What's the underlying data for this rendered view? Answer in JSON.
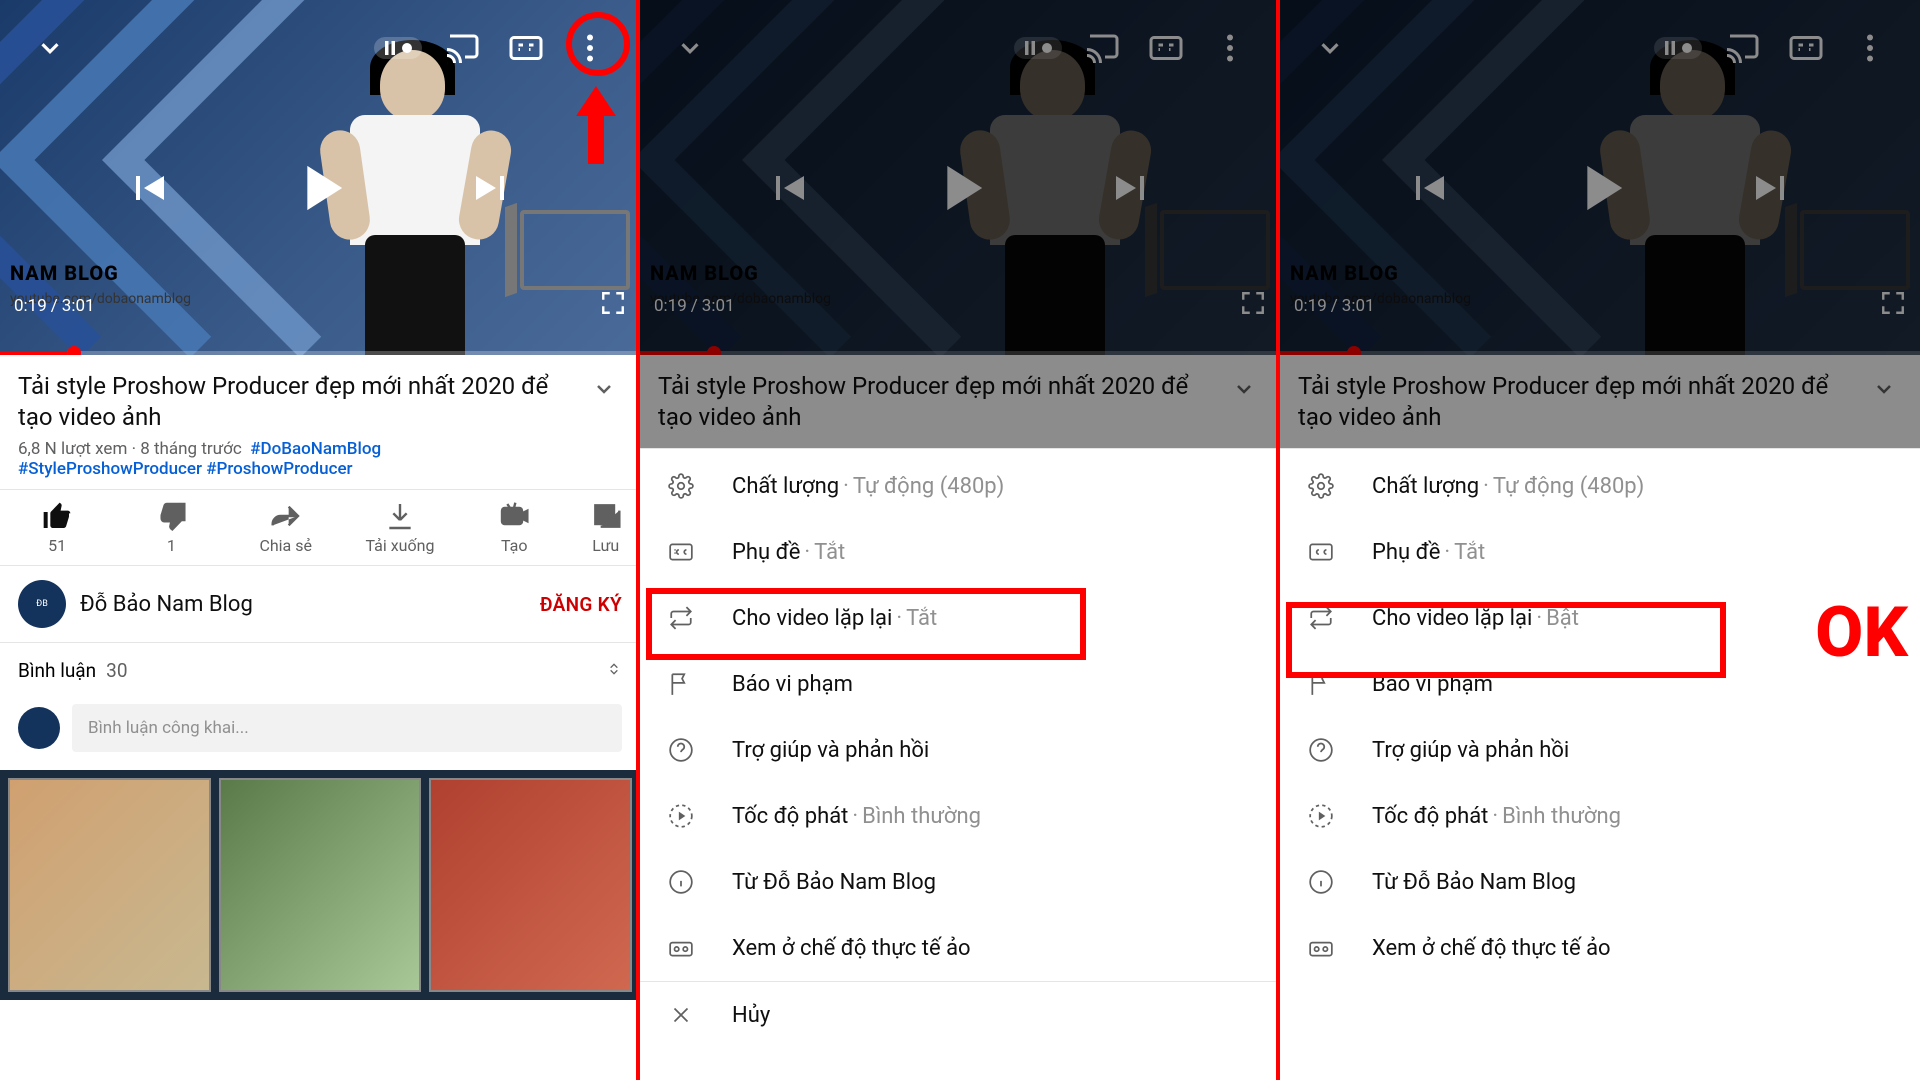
{
  "video": {
    "title": "Tải style Proshow Producer đẹp mới nhất 2020 để tạo video ảnh",
    "time_current": "0:19",
    "time_total": "3:01",
    "views_and_age": "6,8 N lượt xem · 8 tháng trước",
    "brand_text": "NAM BLOG",
    "brand_url": "youtube.com/dobaonamblog",
    "hashtags": [
      "#DoBaoNamBlog",
      "#StyleProshowProducer",
      "#ProshowProducer"
    ]
  },
  "channel": {
    "name": "Đỗ Bảo Nam Blog",
    "subscribe_label": "ĐĂNG KÝ"
  },
  "actions": {
    "like_count": "51",
    "dislike_count": "1",
    "share_label": "Chia sẻ",
    "download_label": "Tải xuống",
    "create_label": "Tạo",
    "save_label": "Lưu"
  },
  "comments": {
    "label": "Bình luận",
    "count": "30",
    "placeholder": "Bình luận công khai..."
  },
  "menu": {
    "quality": {
      "label": "Chất lượng",
      "value": "Tự động (480p)"
    },
    "captions": {
      "label": "Phụ đề",
      "value": "Tắt"
    },
    "loop_panel2": {
      "label": "Cho video lặp lại",
      "value": "Tắt"
    },
    "loop_panel3": {
      "label": "Cho video lặp lại",
      "value": "Bật"
    },
    "report": {
      "label": "Báo vi phạm"
    },
    "help": {
      "label": "Trợ giúp và phản hồi"
    },
    "speed": {
      "label": "Tốc độ phát",
      "value": "Bình thường"
    },
    "from": {
      "label": "Từ Đỗ Bảo Nam Blog"
    },
    "vr": {
      "label": "Xem ở chế độ thực tế ảo"
    },
    "cancel": {
      "label": "Hủy"
    }
  },
  "annotations": {
    "ok": "OK"
  }
}
